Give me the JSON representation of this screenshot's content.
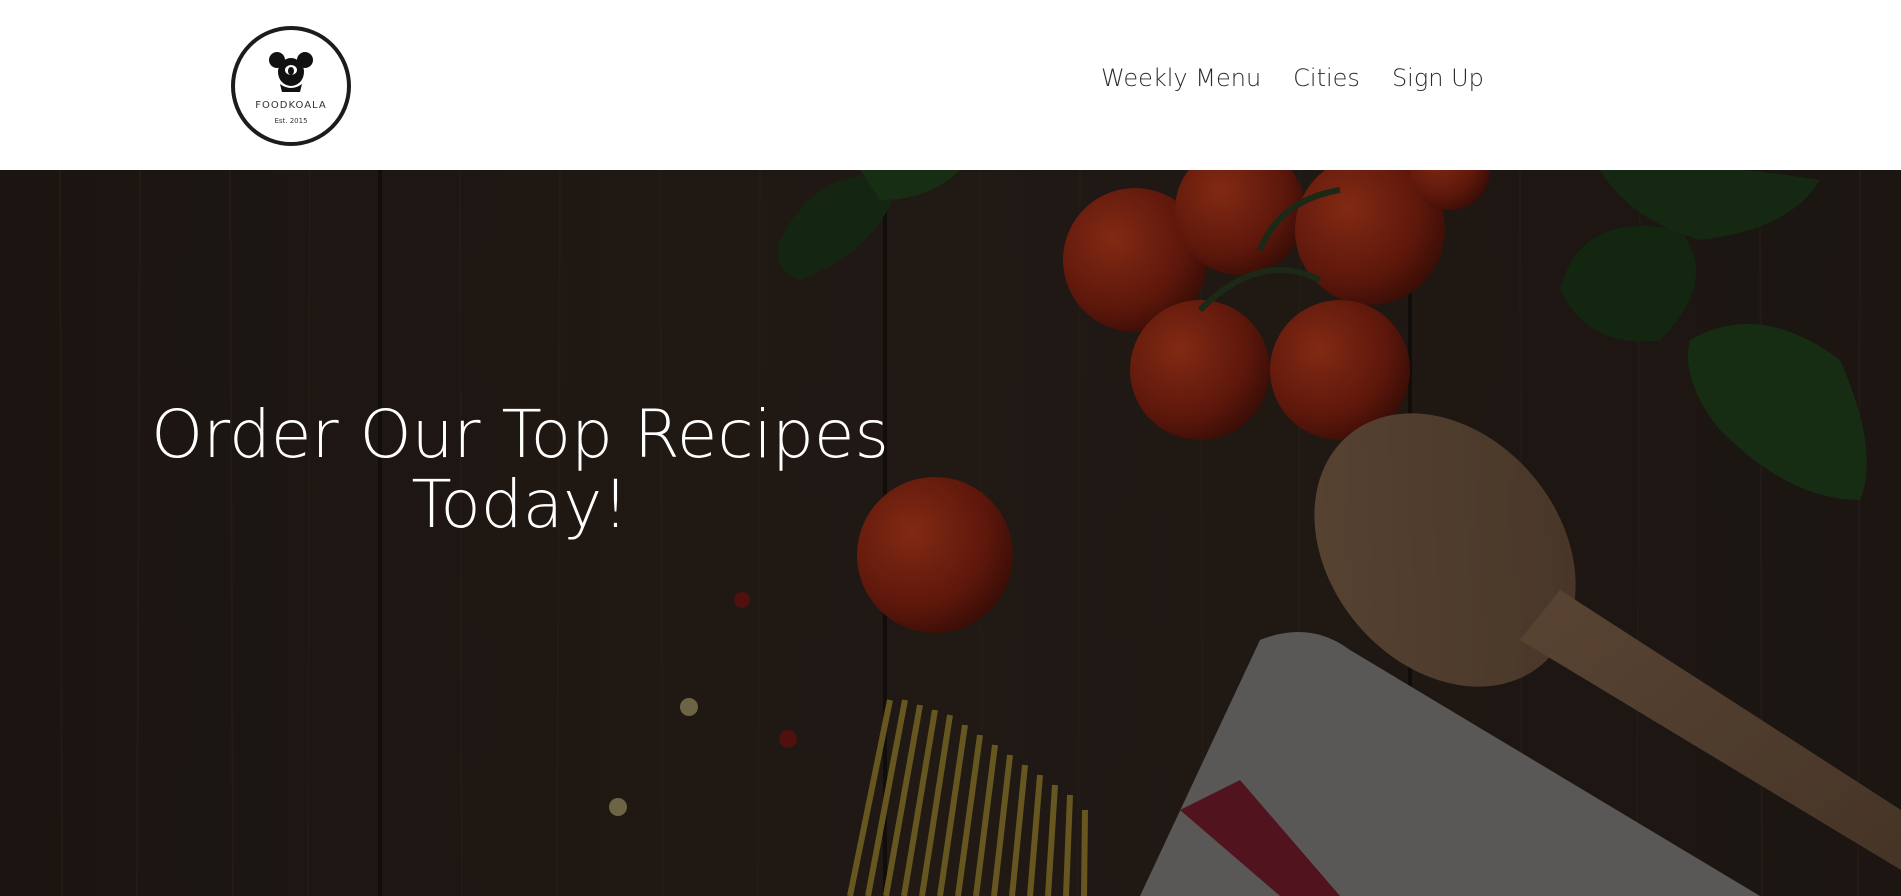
{
  "header": {
    "logo": {
      "name": "FOODKOALA",
      "established": "Est. 2015"
    },
    "nav": [
      {
        "label": "Weekly Menu"
      },
      {
        "label": "Cities"
      },
      {
        "label": "Sign Up"
      }
    ]
  },
  "hero": {
    "title": "Order Our Top Recipes Today!"
  },
  "colors": {
    "header_bg": "#ffffff",
    "nav_text": "#2b2b2b",
    "hero_overlay": "#2e241f",
    "hero_text": "#ffffff"
  }
}
